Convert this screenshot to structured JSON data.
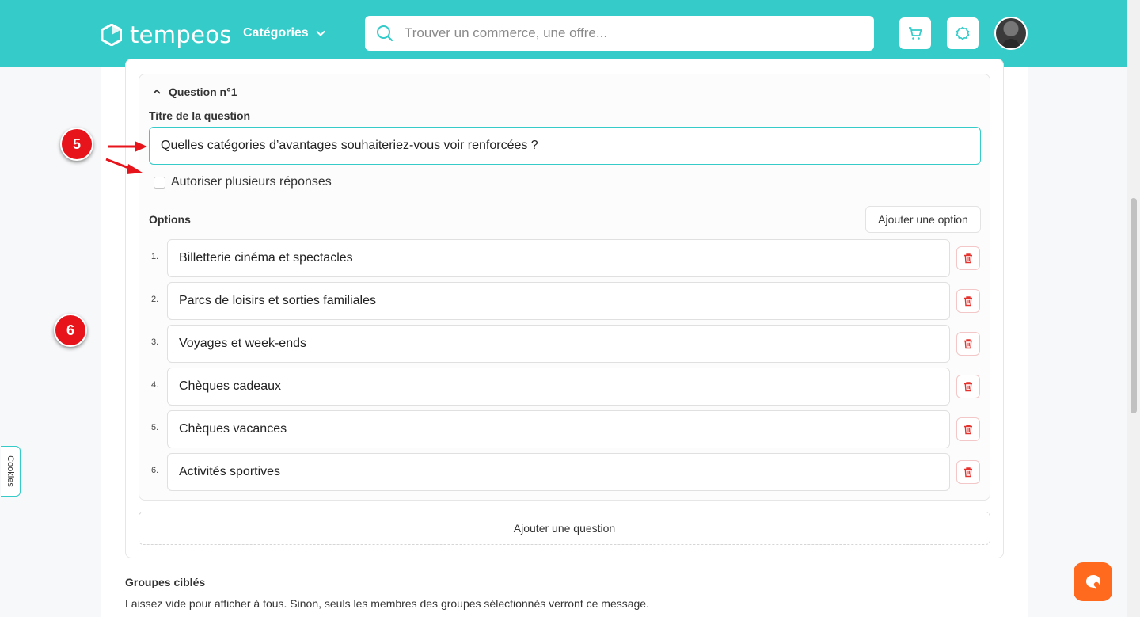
{
  "header": {
    "logo_text": "tempeos",
    "categories_label": "Catégories",
    "search_placeholder": "Trouver un commerce, une offre..."
  },
  "question": {
    "heading": "Question n°1",
    "title_label": "Titre de la question",
    "title_value": "Quelles catégories d’avantages souhaiteriez-vous voir renforcées ?",
    "multi_label": "Autoriser plusieurs réponses",
    "multi_checked": false,
    "options_label": "Options",
    "add_option_label": "Ajouter une option",
    "options": [
      {
        "num": "1.",
        "value": "Billetterie cinéma et spectacles"
      },
      {
        "num": "2.",
        "value": "Parcs de loisirs et sorties familiales"
      },
      {
        "num": "3.",
        "value": "Voyages et week-ends"
      },
      {
        "num": "4.",
        "value": "Chèques cadeaux"
      },
      {
        "num": "5.",
        "value": "Chèques vacances"
      },
      {
        "num": "6.",
        "value": "Activités sportives"
      }
    ]
  },
  "add_question_label": "Ajouter une question",
  "groups": {
    "title": "Groupes ciblés",
    "help": "Laissez vide pour afficher à tous. Sinon, seuls les membres des groupes sélectionnés verront ce message."
  },
  "annotations": {
    "badge_a": "5",
    "badge_b": "6"
  },
  "cookies_label": "Cookies",
  "colors": {
    "brand": "#34cbc9",
    "badge": "#e8141b",
    "chat": "#ff6a1f",
    "delete": "#e5322d"
  }
}
